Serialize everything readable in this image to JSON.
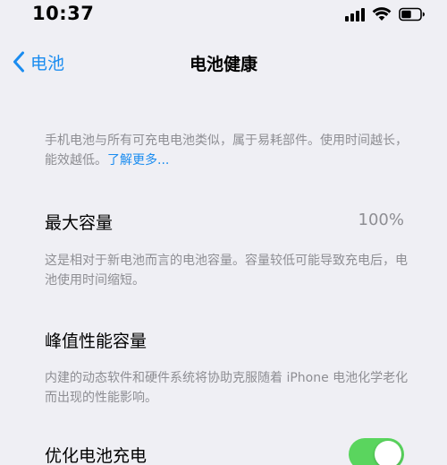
{
  "status_bar": {
    "time": "10:37",
    "icons": [
      "signal-icon",
      "wifi-icon",
      "battery-icon"
    ]
  },
  "nav": {
    "back_label": "电池",
    "title": "电池健康"
  },
  "intro": {
    "text": "手机电池与所有可充电电池类似，属于易耗部件。使用时间越长，能效越低。",
    "link": "了解更多..."
  },
  "max_capacity": {
    "title": "最大容量",
    "value": "100%",
    "description": "这是相对于新电池而言的电池容量。容量较低可能导致充电后，电池使用时间缩短。"
  },
  "peak_performance": {
    "title": "峰值性能容量",
    "description": "内建的动态软件和硬件系统将协助克服随着 iPhone 电池化学老化而出现的性能影响。"
  },
  "optimized_charging": {
    "title": "优化电池充电",
    "enabled": true
  },
  "colors": {
    "accent": "#1a8cf0",
    "toggle_on": "#5ad55e",
    "background": "#efeff4",
    "secondary_text": "#8e8e93"
  }
}
